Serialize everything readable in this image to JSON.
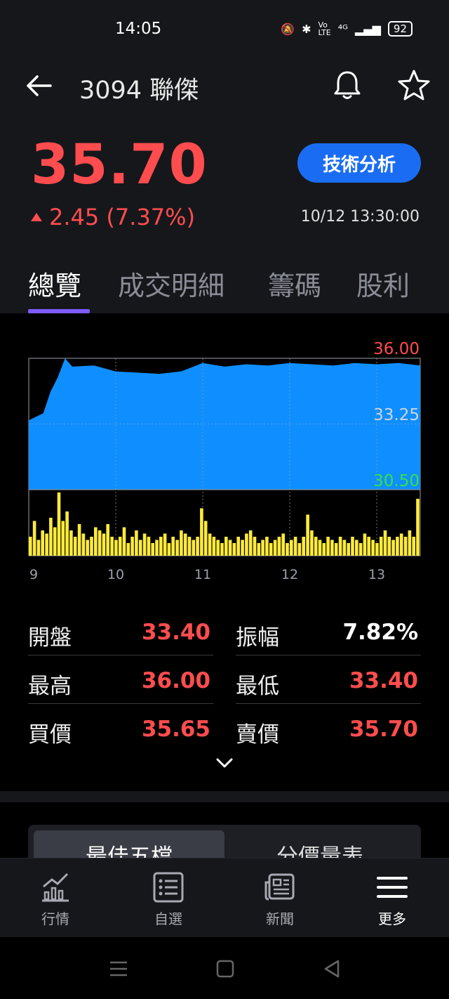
{
  "status_bar": {
    "time": "14:05",
    "signal": "⁴ᴳ",
    "battery": "92"
  },
  "header": {
    "title": "3094 聯傑",
    "price": "35.70",
    "change": "2.45 (7.37%)",
    "timestamp": "10/12 13:30:00",
    "technical_analysis_label": "技術分析",
    "up_color": "#ff4d4f",
    "accent_color": "#1a6df3"
  },
  "tabs": [
    {
      "label": "總覽",
      "active": true
    },
    {
      "label": "成交明細",
      "active": false
    },
    {
      "label": "籌碼",
      "active": false
    },
    {
      "label": "股利",
      "active": false
    }
  ],
  "chart_data": {
    "type": "area",
    "price_axis": {
      "max": "36.00",
      "mid": "33.25",
      "min": "30.50",
      "ylim": [
        30.5,
        36.0
      ]
    },
    "x_tick_labels": [
      "9",
      "10",
      "11",
      "12",
      "13"
    ],
    "price_series": [
      [
        "9:00",
        33.4
      ],
      [
        "9:05",
        33.55
      ],
      [
        "9:10",
        33.7
      ],
      [
        "9:15",
        34.6
      ],
      [
        "9:20",
        35.2
      ],
      [
        "9:25",
        36.0
      ],
      [
        "9:30",
        35.65
      ],
      [
        "9:45",
        35.7
      ],
      [
        "10:00",
        35.45
      ],
      [
        "10:15",
        35.4
      ],
      [
        "10:30",
        35.35
      ],
      [
        "10:45",
        35.45
      ],
      [
        "11:00",
        35.8
      ],
      [
        "11:15",
        35.65
      ],
      [
        "11:30",
        35.75
      ],
      [
        "11:45",
        35.7
      ],
      [
        "12:00",
        35.8
      ],
      [
        "12:15",
        35.75
      ],
      [
        "12:30",
        35.7
      ],
      [
        "12:45",
        35.8
      ],
      [
        "13:00",
        35.75
      ],
      [
        "13:15",
        35.8
      ],
      [
        "13:30",
        35.7
      ]
    ],
    "volume_series": [
      0.3,
      0.55,
      0.25,
      0.4,
      0.35,
      0.6,
      0.45,
      1.0,
      0.55,
      0.7,
      0.4,
      0.3,
      0.5,
      0.35,
      0.25,
      0.3,
      0.45,
      0.4,
      0.35,
      0.5,
      0.3,
      0.25,
      0.3,
      0.45,
      0.2,
      0.3,
      0.4,
      0.25,
      0.35,
      0.3,
      0.2,
      0.25,
      0.3,
      0.35,
      0.2,
      0.3,
      0.25,
      0.4,
      0.35,
      0.3,
      0.25,
      0.3,
      0.75,
      0.55,
      0.35,
      0.3,
      0.25,
      0.2,
      0.3,
      0.25,
      0.2,
      0.3,
      0.25,
      0.35,
      0.4,
      0.3,
      0.2,
      0.25,
      0.3,
      0.2,
      0.25,
      0.3,
      0.35,
      0.2,
      0.25,
      0.3,
      0.2,
      0.3,
      0.65,
      0.4,
      0.3,
      0.25,
      0.2,
      0.3,
      0.25,
      0.2,
      0.3,
      0.25,
      0.2,
      0.3,
      0.25,
      0.2,
      0.35,
      0.3,
      0.25,
      0.2,
      0.3,
      0.4,
      0.3,
      0.25,
      0.3,
      0.35,
      0.3,
      0.4,
      0.3,
      0.9
    ],
    "area_color": "#0f8fff",
    "volume_color": "#ffeb3b",
    "max_color": "#ff4d4f",
    "min_color": "#35e04a"
  },
  "stats": [
    [
      {
        "label": "開盤",
        "value": "33.40",
        "color": "#ff4d4f"
      },
      {
        "label": "振幅",
        "value": "7.82%",
        "color": "#ffffff"
      }
    ],
    [
      {
        "label": "最高",
        "value": "36.00",
        "color": "#ff4d4f"
      },
      {
        "label": "最低",
        "value": "33.40",
        "color": "#ff4d4f"
      }
    ],
    [
      {
        "label": "買價",
        "value": "35.65",
        "color": "#ff4d4f"
      },
      {
        "label": "賣價",
        "value": "35.70",
        "color": "#ff4d4f"
      }
    ]
  ],
  "order_book_tabs": [
    {
      "label": "最佳五檔",
      "active": true
    },
    {
      "label": "分價量表",
      "active": false
    }
  ],
  "bottom_nav": [
    {
      "label": "行情",
      "icon": "market-chart-icon",
      "active": false
    },
    {
      "label": "自選",
      "icon": "watchlist-icon",
      "active": false
    },
    {
      "label": "新聞",
      "icon": "news-icon",
      "active": false
    },
    {
      "label": "更多",
      "icon": "menu-icon",
      "active": true
    }
  ]
}
